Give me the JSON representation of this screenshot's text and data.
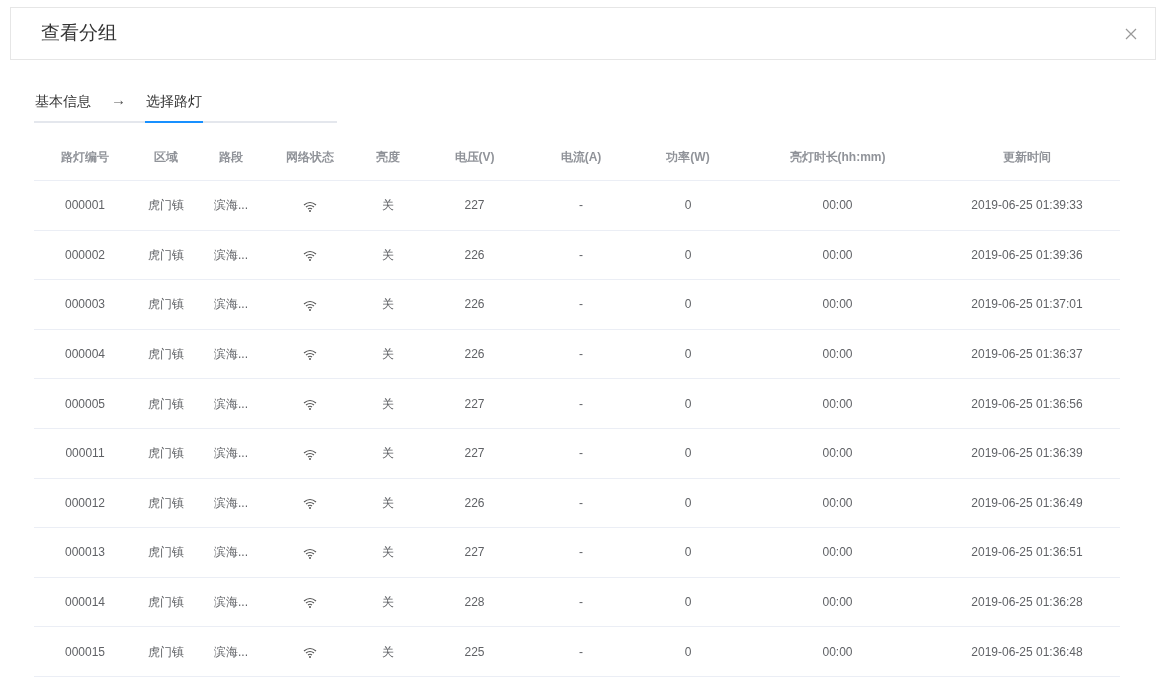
{
  "dialog": {
    "title": "查看分组"
  },
  "steps": [
    {
      "label": "基本信息",
      "selected": false
    },
    {
      "label": "选择路灯",
      "selected": true
    }
  ],
  "steps_separator": "→",
  "table": {
    "columns": [
      "路灯编号",
      "区域",
      "路段",
      "网络状态",
      "亮度",
      "电压(V)",
      "电流(A)",
      "功率(W)",
      "亮灯时长(hh:mm)",
      "更新时间"
    ],
    "rows": [
      [
        "000001",
        "虎门镇",
        "滨海...",
        "",
        "关",
        "227",
        "-",
        "0",
        "00:00",
        "2019-06-25 01:39:33"
      ],
      [
        "000002",
        "虎门镇",
        "滨海...",
        "",
        "关",
        "226",
        "-",
        "0",
        "00:00",
        "2019-06-25 01:39:36"
      ],
      [
        "000003",
        "虎门镇",
        "滨海...",
        "",
        "关",
        "226",
        "-",
        "0",
        "00:00",
        "2019-06-25 01:37:01"
      ],
      [
        "000004",
        "虎门镇",
        "滨海...",
        "",
        "关",
        "226",
        "-",
        "0",
        "00:00",
        "2019-06-25 01:36:37"
      ],
      [
        "000005",
        "虎门镇",
        "滨海...",
        "",
        "关",
        "227",
        "-",
        "0",
        "00:00",
        "2019-06-25 01:36:56"
      ],
      [
        "000011",
        "虎门镇",
        "滨海...",
        "",
        "关",
        "227",
        "-",
        "0",
        "00:00",
        "2019-06-25 01:36:39"
      ],
      [
        "000012",
        "虎门镇",
        "滨海...",
        "",
        "关",
        "226",
        "-",
        "0",
        "00:00",
        "2019-06-25 01:36:49"
      ],
      [
        "000013",
        "虎门镇",
        "滨海...",
        "",
        "关",
        "227",
        "-",
        "0",
        "00:00",
        "2019-06-25 01:36:51"
      ],
      [
        "000014",
        "虎门镇",
        "滨海...",
        "",
        "关",
        "228",
        "-",
        "0",
        "00:00",
        "2019-06-25 01:36:28"
      ],
      [
        "000015",
        "虎门镇",
        "滨海...",
        "",
        "关",
        "225",
        "-",
        "0",
        "00:00",
        "2019-06-25 01:36:48"
      ]
    ]
  }
}
